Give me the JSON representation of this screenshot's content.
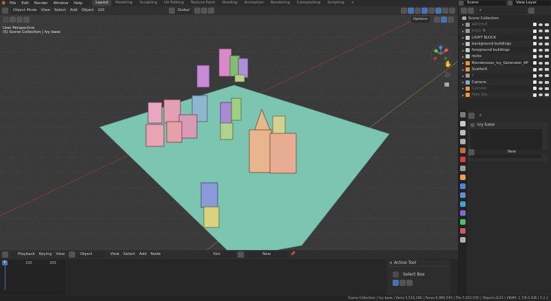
{
  "topbar": {
    "menus": [
      "File",
      "Edit",
      "Render",
      "Window",
      "Help"
    ],
    "workspaces": [
      "Layout",
      "Modeling",
      "Sculpting",
      "UV Editing",
      "Texture Paint",
      "Shading",
      "Animation",
      "Rendering",
      "Compositing",
      "Scripting"
    ],
    "active_workspace": "Layout",
    "scene": "Scene",
    "view_layer": "View Layer"
  },
  "viewport": {
    "mode": "Object Mode",
    "menus": [
      "View",
      "Select",
      "Add",
      "Object",
      "GIS"
    ],
    "orientation": "Global",
    "options_label": "Options",
    "info_line1": "User Perspective",
    "info_line2": "(5) Scene Collection | Ivy base"
  },
  "outliner": {
    "root": "Scene Collection",
    "items": [
      {
        "name": "ARCHIVE",
        "dim": true,
        "tag": ""
      },
      {
        "name": "trees",
        "dim": true,
        "tag": "6"
      },
      {
        "name": "LIGHT BLOCK",
        "dim": false,
        "tag": ""
      },
      {
        "name": "background buildings",
        "dim": false,
        "tag": ""
      },
      {
        "name": "foreground buildings",
        "dim": false,
        "tag": ""
      },
      {
        "name": "rocks",
        "dim": false,
        "tag": ""
      },
      {
        "name": "Blenderesse_Ivy_Generator_AP",
        "dim": false,
        "tag": ""
      },
      {
        "name": "ScatterS",
        "dim": false,
        "tag": ""
      },
      {
        "name": "1",
        "dim": true,
        "tag": ""
      },
      {
        "name": "Camera",
        "dim": false,
        "tag": ""
      },
      {
        "name": "Cylinder",
        "dim": true,
        "tag": ""
      },
      {
        "name": "Fake Sky",
        "dim": true,
        "tag": ""
      }
    ]
  },
  "properties": {
    "object_name": "Ivy base",
    "new_label": "New"
  },
  "timeline": {
    "menus": [
      "Playback",
      "Keying",
      "View"
    ],
    "object_label": "Object",
    "menus2": [
      "View",
      "Select",
      "Add",
      "Node"
    ],
    "slot_label": "Slot",
    "new_label": "New",
    "current_frame": "5",
    "ticks": [
      "100",
      "200"
    ]
  },
  "active_tool": {
    "title": "Active Tool",
    "tool": "Select Box"
  },
  "status": {
    "text": "Scene Collection | Ivy base | Verts:3,516,266 | Faces:6,986,543 | Tris:7,032,030 | Objects:0/23 | VRAM: 1.7/8.0 GiB | 3.2.2"
  },
  "colors": {
    "accent": "#4772b3",
    "ground": "#7cc5b0",
    "timeline_bg": "#272727"
  }
}
